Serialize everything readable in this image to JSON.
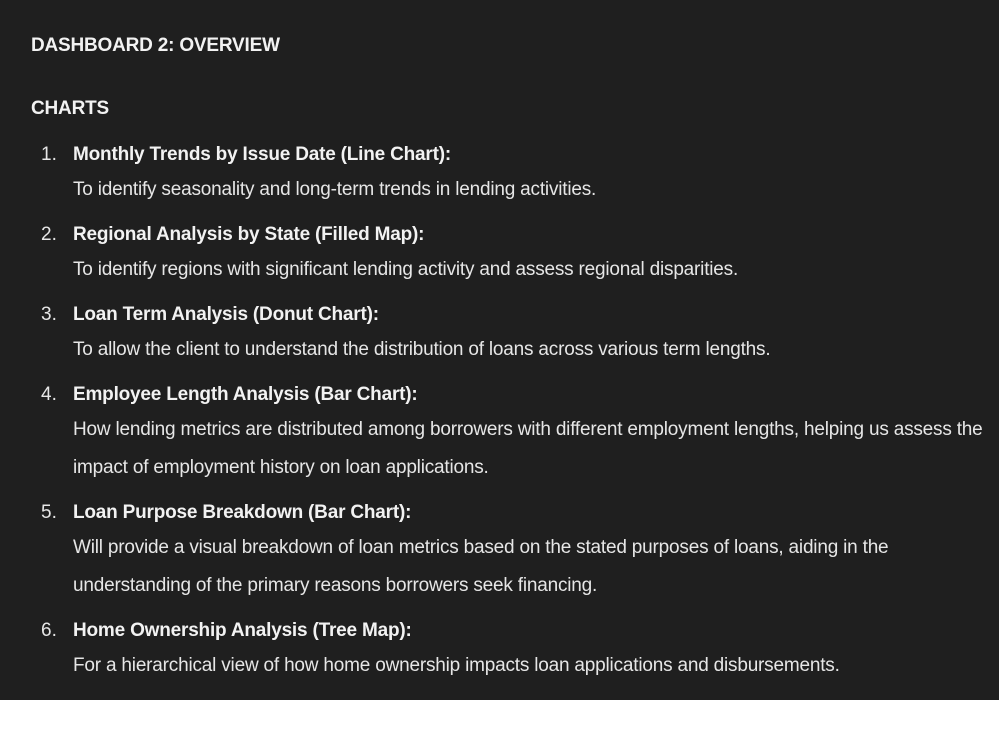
{
  "document": {
    "title": "DASHBOARD 2: OVERVIEW",
    "section_title": "CHARTS",
    "items": [
      {
        "number": "1.",
        "heading": "Monthly Trends by Issue Date (Line Chart):",
        "description": "To identify seasonality and long-term trends in lending activities."
      },
      {
        "number": "2.",
        "heading": "Regional Analysis by State (Filled Map):",
        "description": "To identify regions with significant lending activity and assess regional disparities."
      },
      {
        "number": "3.",
        "heading": "Loan Term Analysis (Donut Chart):",
        "description": "To allow the client to understand the distribution of loans across various term lengths."
      },
      {
        "number": "4.",
        "heading": "Employee Length Analysis (Bar Chart):",
        "description": "How lending metrics are distributed among borrowers with different employment lengths, helping us assess the impact of employment history on loan applications."
      },
      {
        "number": "5.",
        "heading": "Loan Purpose Breakdown (Bar Chart):",
        "description": "Will provide a visual breakdown of loan metrics based on the stated purposes of loans, aiding in the understanding of the primary reasons borrowers seek financing."
      },
      {
        "number": "6.",
        "heading": "Home Ownership Analysis (Tree Map):",
        "description": "For a hierarchical view of how home ownership impacts loan applications and disbursements."
      }
    ]
  },
  "colors": {
    "background": "#1f1f1f",
    "text": "#e6e6e6",
    "heading_text": "#f2f2f2",
    "page_margin": "#ffffff"
  }
}
